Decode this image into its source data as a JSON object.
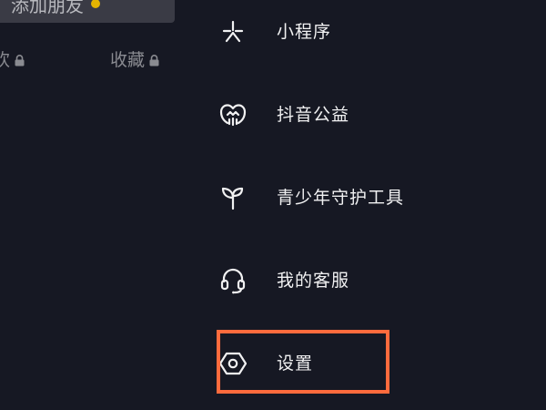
{
  "left_panel": {
    "add_friend_label": "添加朋友",
    "tabs": [
      {
        "label": "欢",
        "locked": true
      },
      {
        "label": "收藏",
        "locked": true
      }
    ]
  },
  "menu": {
    "items": [
      {
        "label": "小程序",
        "icon": "mini-program-icon"
      },
      {
        "label": "抖音公益",
        "icon": "charity-heart-icon"
      },
      {
        "label": "青少年守护工具",
        "icon": "sprout-icon"
      },
      {
        "label": "我的客服",
        "icon": "headset-icon"
      },
      {
        "label": "设置",
        "icon": "settings-hexagon-icon"
      }
    ]
  },
  "highlight": {
    "target": "设置",
    "color": "#ff6b3d"
  },
  "colors": {
    "background": "#161823",
    "text_primary": "#f1f1f2",
    "text_dim": "#8a8b91",
    "accent_dot": "#e5b400"
  }
}
